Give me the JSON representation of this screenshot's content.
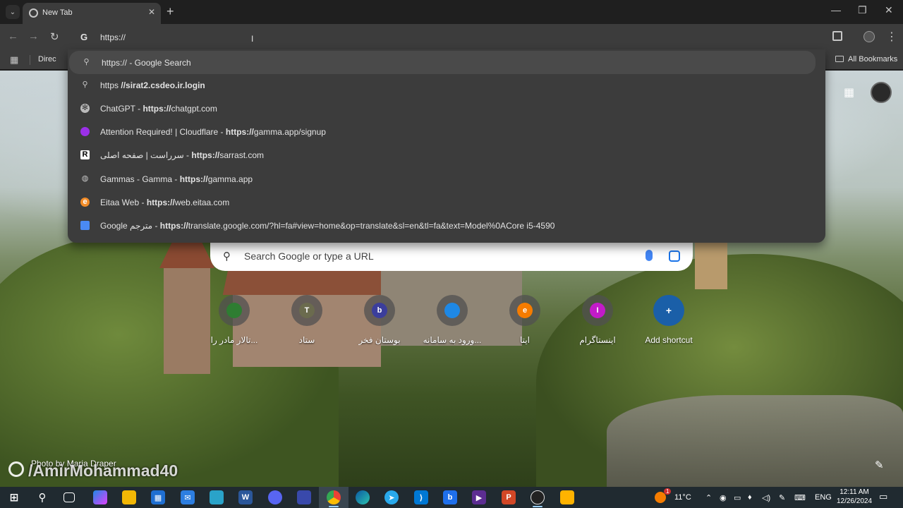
{
  "tab": {
    "title": "New Tab"
  },
  "omnibox": {
    "value": "https://"
  },
  "bookmarks": {
    "first_item": "Direc",
    "all_bookmarks": "All Bookmarks"
  },
  "suggestions": [
    {
      "plain": "https:// - Google Search",
      "bold": "",
      "icon": "search-icon"
    },
    {
      "plain": "https ",
      "bold": "//sirat2.csdeo.ir.login",
      "icon": "search-icon"
    },
    {
      "plain": "ChatGPT - ",
      "bold": "https://",
      "rest": "chatgpt.com",
      "icon": "chatgpt-icon"
    },
    {
      "plain": "Attention Required! | Cloudflare - ",
      "bold": "https://",
      "rest": "gamma.app/signup",
      "icon": "gamma-icon"
    },
    {
      "plain": "سرراست | صفحه اصلی - ",
      "bold": "https://",
      "rest": "sarrast.com",
      "icon": "sarrast-icon"
    },
    {
      "plain": "Gammas - Gamma - ",
      "bold": "https://",
      "rest": "gamma.app",
      "icon": "globe-icon"
    },
    {
      "plain": "Eitaa Web - ",
      "bold": "https://",
      "rest": "web.eitaa.com",
      "icon": "eitaa-icon"
    },
    {
      "plain": "Google مترجم - ",
      "bold": "https://",
      "rest": "translate.google.com/?hl=fa#view=home&op=translate&sl=en&tl=fa&text=Model%0ACore i5-4590",
      "icon": "translate-icon"
    }
  ],
  "ntp": {
    "search_placeholder": "Search Google or type a URL"
  },
  "shortcuts": [
    {
      "label": "تالار مادر را...",
      "letter": "",
      "color": "#2e7d32"
    },
    {
      "label": "ستاد",
      "letter": "T",
      "color": "#6b6b4e"
    },
    {
      "label": "بوستان فخر",
      "letter": "b",
      "color": "#3b3e9c"
    },
    {
      "label": "ورود به سامانه...",
      "letter": "",
      "color": "#1e88e5"
    },
    {
      "label": "ایتا",
      "letter": "e",
      "color": "#f57c00"
    },
    {
      "label": "اینستاگرام",
      "letter": "I",
      "color": "#c21bc9"
    },
    {
      "label": "Add shortcut",
      "letter": "+",
      "color": "#1565c0"
    }
  ],
  "overlay": {
    "photo_credit": "Photo by Maria Draper",
    "watermark": "/AmirMohammad40"
  },
  "taskbar": {
    "temperature": "11°C",
    "language": "ENG",
    "time": "12:11 AM",
    "date": "12/26/2024",
    "weather_badge": "1"
  }
}
